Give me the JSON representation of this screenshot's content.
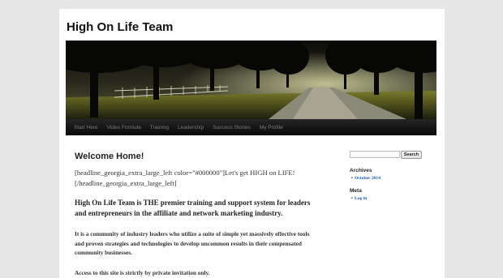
{
  "site": {
    "title": "High On Life Team"
  },
  "nav": {
    "items": [
      {
        "label": "Start Here"
      },
      {
        "label": "Video Formula"
      },
      {
        "label": "Training"
      },
      {
        "label": "Leadership"
      },
      {
        "label": "Success Stories"
      },
      {
        "label": "My Profile"
      }
    ]
  },
  "main": {
    "title": "Welcome Home!",
    "shortcode": "[headline_georgia_extra_large_left color=\"#000000\"]Let's get HIGH on LIFE! [/headline_georgia_extra_large_left]",
    "intro": "High On Life Team is THE premier training and support system for leaders and entrepreneurs in the affiliate and network marketing industry.",
    "body": "It is a community of industry leaders who utilize a suite of simple yet massively effective tools and proven strategies and technologies to develop uncommon results in their compensated community businesses.",
    "access_note": "Access to this site is strictly by private invitation only."
  },
  "sidebar": {
    "search": {
      "value": "",
      "placeholder": "",
      "button_label": "Search"
    },
    "archives": {
      "title": "Archives",
      "items": [
        "October 2014"
      ]
    },
    "meta": {
      "title": "Meta",
      "items": [
        "Log in"
      ]
    }
  },
  "colors": {
    "background": "#e6e6e6",
    "nav_bg": "#1a1a1a",
    "link": "#1b5aa8"
  }
}
